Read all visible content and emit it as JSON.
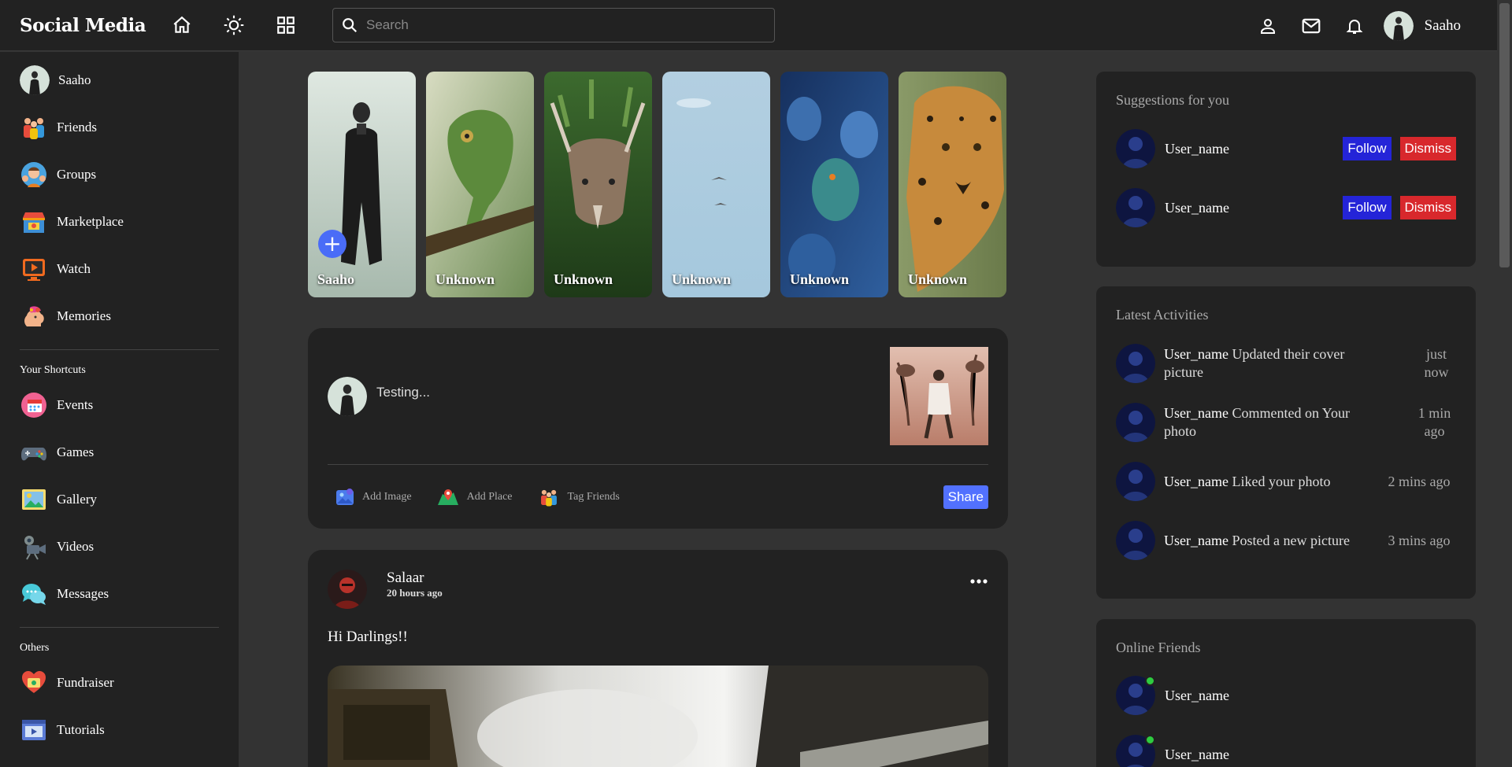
{
  "navbar": {
    "logo": "Social Media",
    "search_placeholder": "Search",
    "user_name": "Saaho"
  },
  "sidebar": {
    "user_name": "Saaho",
    "items": [
      {
        "label": "Friends",
        "icon": "friends-icon"
      },
      {
        "label": "Groups",
        "icon": "groups-icon"
      },
      {
        "label": "Marketplace",
        "icon": "marketplace-icon"
      },
      {
        "label": "Watch",
        "icon": "watch-icon"
      },
      {
        "label": "Memories",
        "icon": "memories-icon"
      }
    ],
    "shortcuts_title": "Your Shortcuts",
    "shortcuts": [
      {
        "label": "Events",
        "icon": "events-icon"
      },
      {
        "label": "Games",
        "icon": "games-icon"
      },
      {
        "label": "Gallery",
        "icon": "gallery-icon"
      },
      {
        "label": "Videos",
        "icon": "videos-icon"
      },
      {
        "label": "Messages",
        "icon": "messages-icon"
      }
    ],
    "others_title": "Others",
    "others": [
      {
        "label": "Fundraiser",
        "icon": "fundraiser-icon"
      },
      {
        "label": "Tutorials",
        "icon": "tutorials-icon"
      }
    ]
  },
  "stories": [
    {
      "name": "Saaho",
      "colors": [
        "#d9e4dc",
        "#7f9488"
      ]
    },
    {
      "name": "Unknown",
      "colors": [
        "#c9d3b4",
        "#4b6b3a"
      ]
    },
    {
      "name": "Unknown",
      "colors": [
        "#2e4a26",
        "#8a7260"
      ]
    },
    {
      "name": "Unknown",
      "colors": [
        "#bcd5e4",
        "#9ec2d8"
      ]
    },
    {
      "name": "Unknown",
      "colors": [
        "#1d3b74",
        "#3a6fb1"
      ]
    },
    {
      "name": "Unknown",
      "colors": [
        "#8e9a6a",
        "#b07a3a"
      ]
    }
  ],
  "composer": {
    "value": "Testing...",
    "add_image": "Add Image",
    "add_place": "Add Place",
    "tag_friends": "Tag Friends",
    "share_label": "Share"
  },
  "post": {
    "author": "Salaar",
    "time": "20 hours ago",
    "text": "Hi Darlings!!"
  },
  "suggestions": {
    "title": "Suggestions for you",
    "follow_label": "Follow",
    "dismiss_label": "Dismiss",
    "users": [
      {
        "name": "User_name"
      },
      {
        "name": "User_name"
      }
    ]
  },
  "activities": {
    "title": "Latest Activities",
    "items": [
      {
        "user": "User_name",
        "action": "Updated their cover picture",
        "time": "just now"
      },
      {
        "user": "User_name",
        "action": "Commented on Your photo",
        "time": "1 min ago"
      },
      {
        "user": "User_name",
        "action": "Liked your photo",
        "time": "2 mins ago"
      },
      {
        "user": "User_name",
        "action": "Posted a new picture",
        "time": "3 mins ago"
      }
    ]
  },
  "online": {
    "title": "Online Friends",
    "users": [
      {
        "name": "User_name"
      },
      {
        "name": "User_name"
      }
    ]
  },
  "colors": {
    "background": "#333333",
    "panel": "#222222",
    "accent": "#5271ff",
    "follow": "#2424d8",
    "dismiss": "#d8282c",
    "online": "#2ecc40"
  }
}
